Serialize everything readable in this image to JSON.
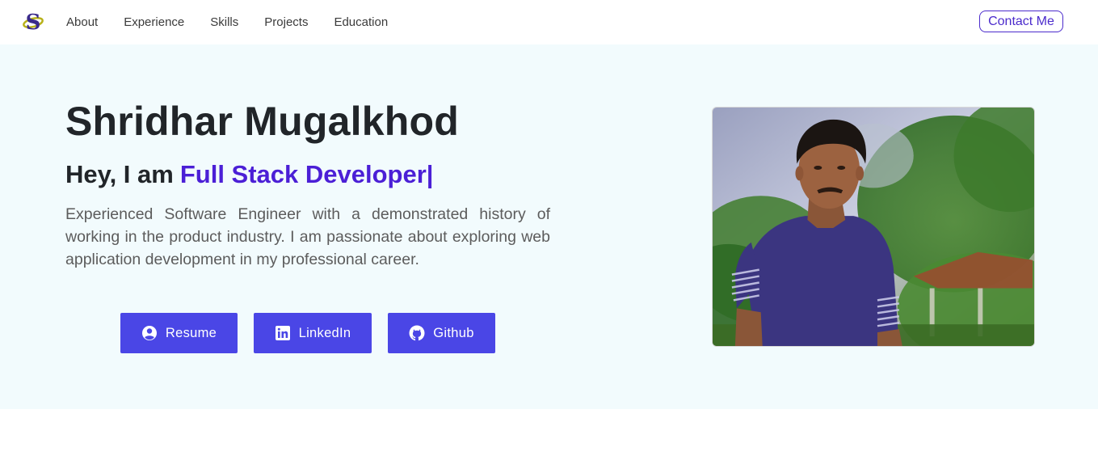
{
  "nav": {
    "logo_alt": "S logo",
    "links": [
      "About",
      "Experience",
      "Skills",
      "Projects",
      "Education"
    ],
    "contact_label": "Contact Me"
  },
  "hero": {
    "name": "Shridhar Mugalkhod",
    "greeting": "Hey, I am",
    "role": "Full Stack Developer|",
    "description": "Experienced Software Engineer with a demonstrated history of working in the product industry. I am passionate about exploring web application development in my professional career.",
    "buttons": {
      "resume": "Resume",
      "linkedin": "LinkedIn",
      "github": "Github"
    },
    "photo_icon": "profile-photo"
  },
  "colors": {
    "accent": "#4b1fd6",
    "button_bg": "#4a46e6",
    "hero_bg": "#f2fbfd",
    "contact_border": "#4b2bcc"
  }
}
